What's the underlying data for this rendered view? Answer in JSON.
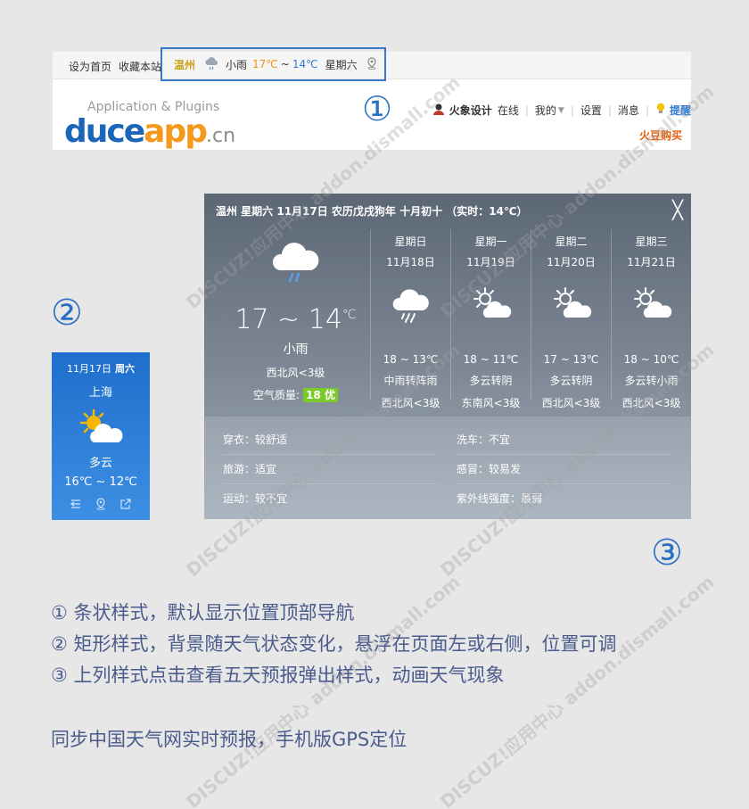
{
  "topbar": {
    "set_home": "设为首页",
    "bookmark": "收藏本站",
    "weather": {
      "city": "温州",
      "condition": "小雨",
      "high": "17℃",
      "tilde": "~",
      "low": "14℃",
      "weekday": "星期六",
      "icon": "light-rain-icon"
    }
  },
  "brand": {
    "tagline": "Application & Plugins",
    "logo_part1": "duce",
    "logo_part2": "app",
    "logo_suffix": ".cn"
  },
  "markers": {
    "one": "①",
    "two": "②",
    "three": "③"
  },
  "user": {
    "name": "火象设计",
    "status": "在线",
    "mine": "我的",
    "settings": "设置",
    "messages": "消息",
    "tip": "提醒",
    "buy": "火豆购买"
  },
  "box_widget": {
    "date": "11月17日",
    "weekday": "周六",
    "city": "上海",
    "icon": "partly-cloudy-icon",
    "condition": "多云",
    "temp": "16℃ ~ 12℃",
    "colors": {
      "top": "#1f6ecd",
      "bottom": "#3d8fe2"
    }
  },
  "popup": {
    "title": "温州  星期六 11月17日  农历戊戌狗年 十月初十 （实时：14℃）",
    "close": "╳",
    "today": {
      "icon": "light-rain-icon",
      "temp": "17 ~ 14",
      "unit": "℃",
      "condition": "小雨",
      "wind": "西北风<3级",
      "aqi_label": "空气质量:",
      "aqi_value": "18 优"
    },
    "forecast": [
      {
        "day": "星期日",
        "date": "11月18日",
        "icon": "rain-icon",
        "temp": "18 ~ 13℃",
        "desc": "中雨转阵雨",
        "wind": "西北风<3级"
      },
      {
        "day": "星期一",
        "date": "11月19日",
        "icon": "partly-cloudy-icon",
        "temp": "18 ~ 11℃",
        "desc": "多云转阴",
        "wind": "东南风<3级"
      },
      {
        "day": "星期二",
        "date": "11月20日",
        "icon": "partly-cloudy-icon",
        "temp": "17 ~ 13℃",
        "desc": "多云转阴",
        "wind": "西北风<3级"
      },
      {
        "day": "星期三",
        "date": "11月21日",
        "icon": "partly-cloudy-icon",
        "temp": "18 ~ 10℃",
        "desc": "多云转小雨",
        "wind": "西北风<3级"
      }
    ],
    "life": [
      {
        "label": "穿衣：较舒适"
      },
      {
        "label": "洗车：不宜"
      },
      {
        "label": "旅游：适宜"
      },
      {
        "label": "感冒：较易发"
      },
      {
        "label": "运动：较不宜"
      },
      {
        "label": "紫外线强度：最弱"
      }
    ]
  },
  "notes": [
    "① 条状样式，默认显示位置顶部导航",
    "② 矩形样式，背景随天气状态变化，悬浮在页面左或右侧，位置可调",
    "③ 上列样式点击查看五天预报弹出样式，动画天气现象"
  ],
  "sync_note": "同步中国天气网实时预报，手机版GPS定位",
  "watermark": "DISCUZ!应用中心 addon.dismall.com"
}
